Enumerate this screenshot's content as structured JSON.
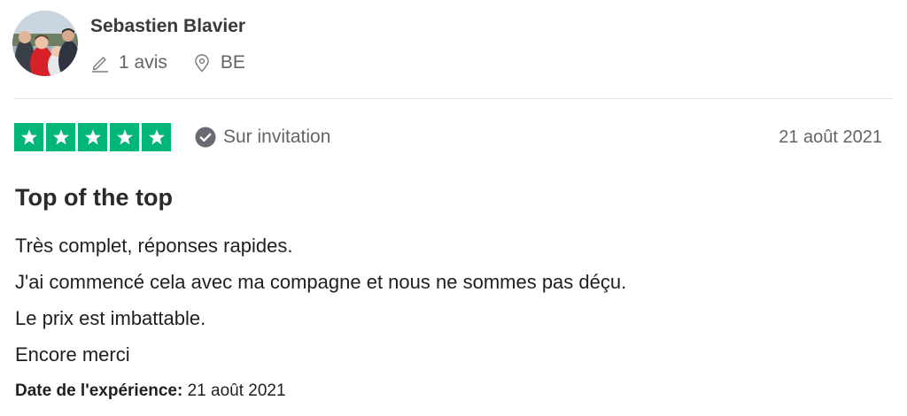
{
  "reviewer": {
    "name": "Sebastien Blavier",
    "reviews_count": "1 avis",
    "country": "BE"
  },
  "rating": {
    "stars": 5,
    "max_stars": 5,
    "verification": "Sur invitation",
    "date": "21 août 2021"
  },
  "review": {
    "title": "Top of the top",
    "lines": [
      "Très complet, réponses rapides.",
      "J'ai commencé cela avec ma compagne et nous ne sommes pas déçu.",
      "Le prix est imbattable.",
      "Encore merci"
    ],
    "experience_label": "Date de l'expérience:",
    "experience_date": "21 août 2021"
  },
  "colors": {
    "star_green": "#00b67a",
    "meta_gray": "#626469",
    "divider": "#e3e3e6"
  },
  "icons": {
    "reviews": "pencil-icon",
    "location": "location-pin-icon",
    "verified": "check-circle-icon",
    "star": "star-icon"
  }
}
